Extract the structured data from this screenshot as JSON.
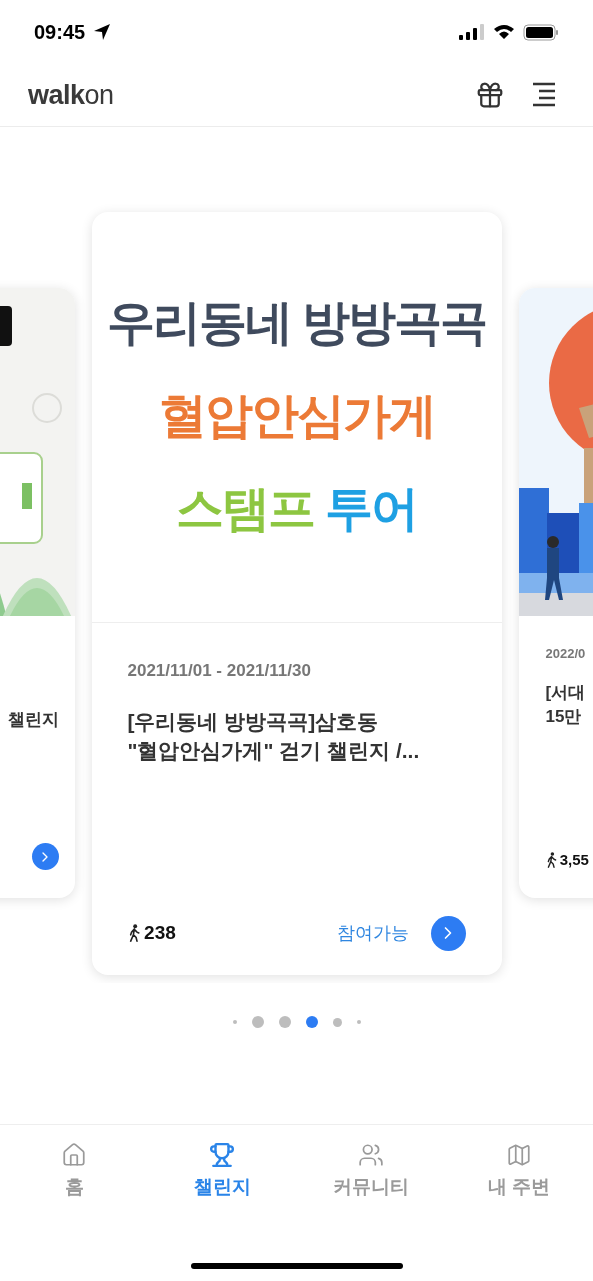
{
  "status_bar": {
    "time": "09:45"
  },
  "header": {
    "logo": "**walk**on"
  },
  "carousel": {
    "cards": [
      {
        "kind": "partial_left",
        "title_lines": [
          "챌린지"
        ]
      },
      {
        "kind": "full",
        "banner": [
          {
            "segments": [
              {
                "text": "우리동네 방방곡곡",
                "color": "#3f4a5d"
              }
            ]
          },
          {
            "segments": [
              {
                "text": "혈압안심가게",
                "color": "#ec7a36"
              }
            ]
          },
          {
            "segments": [
              {
                "text": "스탬프",
                "color": "#8dc641"
              },
              {
                "text": "투어",
                "color": "#1ea0e3"
              }
            ]
          }
        ],
        "dates": "2021/11/01 - 2021/11/30",
        "title_lines": [
          "[우리동네 방방곡곡]삼호동",
          "\"혈압안심가게\" 걷기 챌린지 /..."
        ],
        "walkers": "238",
        "status": "참여가능"
      },
      {
        "kind": "partial_right",
        "dates": "2022/0",
        "title_lines": [
          "[서대",
          "15만"
        ],
        "walkers": "3,55"
      }
    ]
  },
  "pager": [
    {
      "selected": false
    },
    {
      "selected": false
    },
    {
      "selected": false
    },
    {
      "selected": true
    },
    {
      "selected": false
    },
    {
      "selected": false
    }
  ],
  "tab_bar": [
    {
      "kind": "home",
      "label": "홈",
      "selected": false
    },
    {
      "kind": "challenge",
      "label": "챌린지",
      "selected": true
    },
    {
      "kind": "community",
      "label": "커뮤니티",
      "selected": false
    },
    {
      "kind": "nearby",
      "label": "내 주변",
      "selected": false
    }
  ]
}
